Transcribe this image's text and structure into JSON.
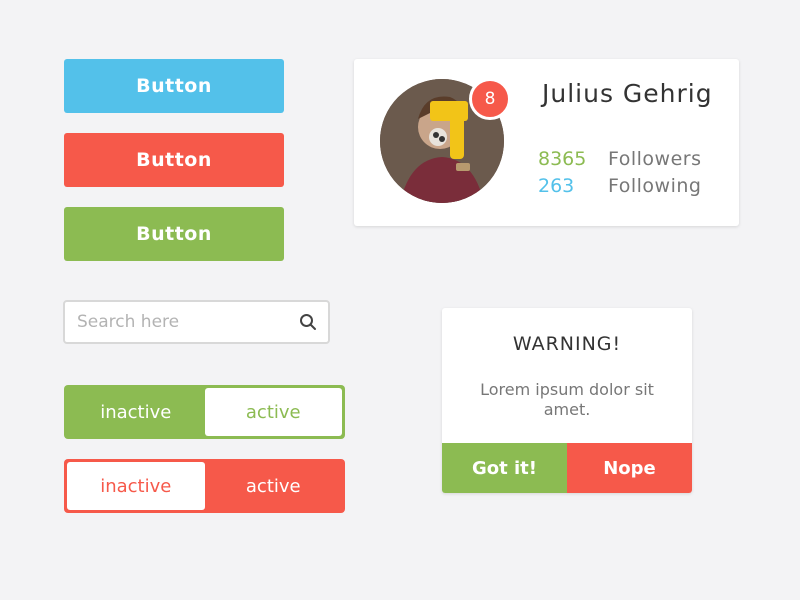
{
  "buttons": {
    "blue_label": "Button",
    "red_label": "Button",
    "green_label": "Button"
  },
  "search": {
    "placeholder": "Search here",
    "icon": "search-icon"
  },
  "toggles": {
    "green": {
      "left": "inactive",
      "right": "active",
      "selected": "right"
    },
    "red": {
      "left": "inactive",
      "right": "active",
      "selected": "left"
    }
  },
  "profile": {
    "name": "Julius Gehrig",
    "badge_count": "8",
    "followers_count": "8365",
    "followers_label": "Followers",
    "following_count": "263",
    "following_label": "Following"
  },
  "dialog": {
    "title": "WARNING!",
    "message": "Lorem ipsum dolor sit amet.",
    "confirm_label": "Got it!",
    "cancel_label": "Nope"
  },
  "colors": {
    "blue": "#53c1ea",
    "red": "#f6594a",
    "green": "#8cbb52",
    "background": "#f3f3f5"
  }
}
